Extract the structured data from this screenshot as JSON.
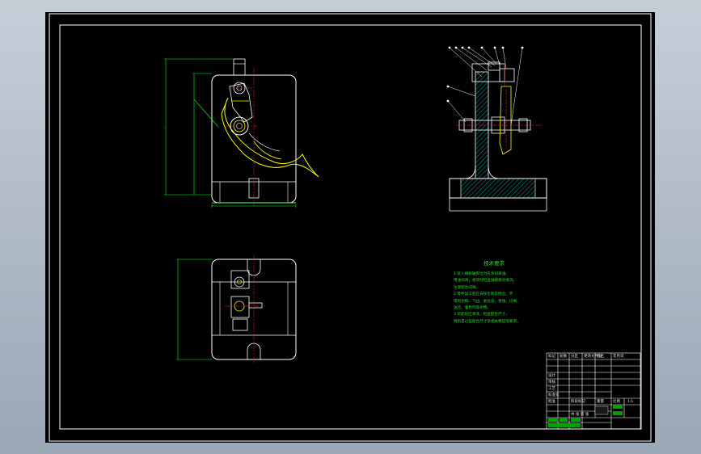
{
  "drawing": {
    "background": "#000000",
    "border_color": "#ffffff",
    "part_color": "#ffffff",
    "dimension_color": "#00ff00",
    "centerline_color": "#ff2020",
    "handle_color": "#ffff00",
    "section_hatch_color": "#00c8c8"
  },
  "technical_notes": {
    "title": "技术要求",
    "lines": [
      "1.装入端联轴部位时先涂润滑油，",
      "用油润滑，组装时检查轴端跳动情况，",
      "注意配合间隙。",
      "2.零件加工后应去除毛刺及锐边，不",
      "得有划痕、飞边、氧化皮、锈蚀、切屑、",
      "油污、着色剂等杂物。",
      "3.装配前应清洗，检查配合尺寸，",
      "特别是过盈配合尺寸及相关精度等要求。"
    ]
  },
  "title_block": {
    "header_labels": [
      "标记",
      "处数",
      "分区",
      "更改文件号",
      "签名",
      "年月日"
    ],
    "row_labels": [
      "设计",
      "审核",
      "工艺",
      "标准化",
      "批准"
    ],
    "scale_labels": [
      "阶段标记",
      "重量",
      "比例"
    ],
    "scale_value": "1:1",
    "sheet_info": "共 张 第 张"
  }
}
